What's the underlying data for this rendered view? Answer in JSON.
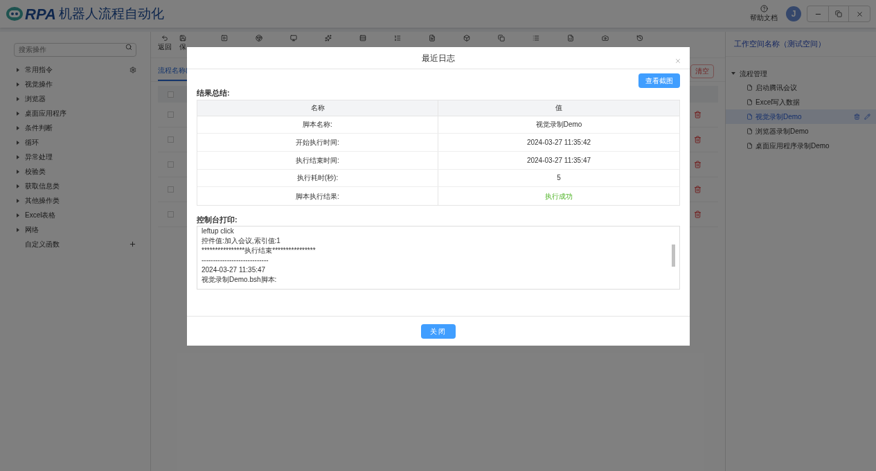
{
  "app": {
    "logo_text": "RPA",
    "title": "机器人流程自动化",
    "help": "帮助文档",
    "avatar": "J"
  },
  "sidebar": {
    "search_placeholder": "搜索操作",
    "items": [
      {
        "label": "常用指令",
        "kind": "settings"
      },
      {
        "label": "视觉操作",
        "kind": "group"
      },
      {
        "label": "浏览器",
        "kind": "group"
      },
      {
        "label": "桌面应用程序",
        "kind": "group"
      },
      {
        "label": "条件判断",
        "kind": "group"
      },
      {
        "label": "循环",
        "kind": "group"
      },
      {
        "label": "异常处理",
        "kind": "group"
      },
      {
        "label": "校验类",
        "kind": "group"
      },
      {
        "label": "获取信息类",
        "kind": "group"
      },
      {
        "label": "其他操作类",
        "kind": "group"
      },
      {
        "label": "Excel表格",
        "kind": "group"
      },
      {
        "label": "网络",
        "kind": "group"
      },
      {
        "label": "自定义函数",
        "kind": "custom"
      }
    ]
  },
  "toolbar": {
    "buttons": [
      "返回",
      "保"
    ]
  },
  "main": {
    "tab": {
      "label": "流程名称(",
      "selected": true
    },
    "clear_button": "清空",
    "header_checked": false,
    "rows": [
      {
        "checked": false
      },
      {
        "checked": false
      },
      {
        "checked": false
      },
      {
        "checked": false
      },
      {
        "checked": false
      }
    ]
  },
  "workspace": {
    "title": "工作空间名称（测试空间）",
    "folder": {
      "label": "流程管理",
      "expanded": true,
      "children": [
        {
          "label": "启动腾讯会议",
          "selected": false
        },
        {
          "label": "Excel写入数据",
          "selected": false
        },
        {
          "label": "视觉录制Demo",
          "selected": true
        },
        {
          "label": "浏览器录制Demo",
          "selected": false
        },
        {
          "label": "桌面应用程序录制Demo",
          "selected": false
        }
      ]
    }
  },
  "dialog": {
    "title": "最近日志",
    "screenshot_button": "查看截图",
    "summary_label": "结果总结:",
    "columns": [
      "名称",
      "值"
    ],
    "rows": [
      {
        "name": "脚本名称:",
        "value": "视觉录制Demo",
        "kind": "plain"
      },
      {
        "name": "开始执行时间:",
        "value": "2024-03-27 11:35:42",
        "kind": "plain"
      },
      {
        "name": "执行结束时间:",
        "value": "2024-03-27 11:35:47",
        "kind": "plain"
      },
      {
        "name": "执行耗时(秒):",
        "value": "5",
        "kind": "plain"
      },
      {
        "name": "脚本执行结果:",
        "value": "执行成功",
        "kind": "success"
      }
    ],
    "console_label": "控制台打印:",
    "console_lines": [
      "leftup click",
      "控件值:加入会议,索引值:1",
      "****************执行结束****************",
      "-----------------------------",
      "2024-03-27 11:35:47",
      "视觉录制Demo.bsh脚本:"
    ],
    "close_button": "关闭"
  }
}
